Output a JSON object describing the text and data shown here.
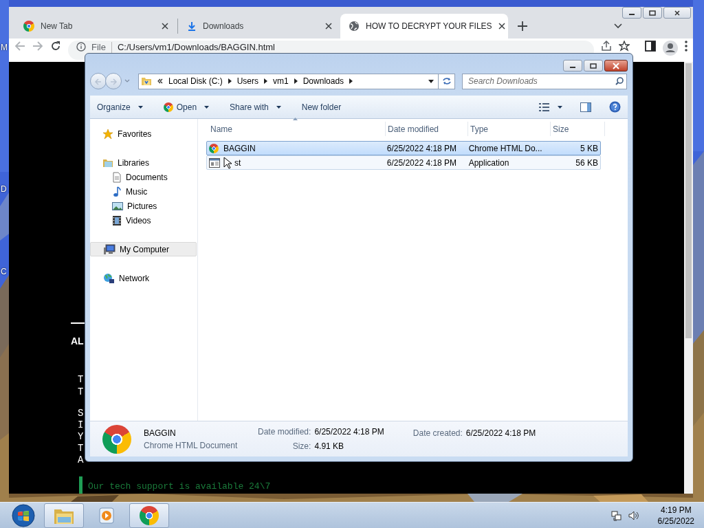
{
  "desktop": {
    "icon_labels": [
      "M",
      "D",
      "C"
    ]
  },
  "browser": {
    "tabs": [
      {
        "title": "New Tab",
        "selected": false
      },
      {
        "title": "Downloads",
        "selected": false
      },
      {
        "title": "HOW TO DECRYPT YOUR FILES",
        "selected": true
      }
    ],
    "address": {
      "scheme": "File",
      "url": "C:/Users/vm1/Downloads/BAGGIN.html"
    },
    "page": {
      "heading": "AL",
      "lines": [
        "T",
        "T",
        "S",
        "I",
        "Y",
        "T",
        "A"
      ],
      "support": "Our tech support is available 24\\7"
    }
  },
  "explorer": {
    "breadcrumb": [
      "Local Disk (C:)",
      "Users",
      "vm1",
      "Downloads"
    ],
    "search": {
      "placeholder": "Search Downloads"
    },
    "toolbar": [
      {
        "label": "Organize",
        "has_menu": true
      },
      {
        "label": "Open",
        "has_menu": true
      },
      {
        "label": "Share with",
        "has_menu": true
      },
      {
        "label": "New folder",
        "has_menu": false
      }
    ],
    "nav": [
      {
        "label": "Favorites",
        "selected": false
      },
      {
        "label": "Libraries",
        "selected": false,
        "children": [
          {
            "label": "Documents",
            "selected": false
          },
          {
            "label": "Music",
            "selected": false
          },
          {
            "label": "Pictures",
            "selected": false
          },
          {
            "label": "Videos",
            "selected": false
          }
        ]
      },
      {
        "label": "My Computer",
        "selected": true
      },
      {
        "label": "Network",
        "selected": false
      }
    ],
    "columns": [
      "Name",
      "Date modified",
      "Type",
      "Size"
    ],
    "files": [
      {
        "name": "BAGGIN",
        "date": "6/25/2022 4:18 PM",
        "type": "Chrome HTML Do...",
        "size": "5 KB",
        "kind": "html",
        "selected": true
      },
      {
        "name": "st",
        "date": "6/25/2022 4:18 PM",
        "type": "Application",
        "size": "56 KB",
        "kind": "application",
        "selected": false
      }
    ],
    "details": {
      "name": "BAGGIN",
      "type": "Chrome HTML Document",
      "fields": [
        {
          "label": "Date modified:",
          "value": "6/25/2022 4:18 PM"
        },
        {
          "label": "Size:",
          "value": "4.91 KB"
        },
        {
          "label": "Date created:",
          "value": "6/25/2022 4:18 PM"
        }
      ]
    }
  },
  "taskbar": {
    "apps": [
      {
        "kind": "explorer",
        "running": true
      },
      {
        "kind": "media",
        "running": false
      },
      {
        "kind": "chrome",
        "running": true
      }
    ],
    "time": "4:19 PM",
    "date": "6/25/2022"
  }
}
